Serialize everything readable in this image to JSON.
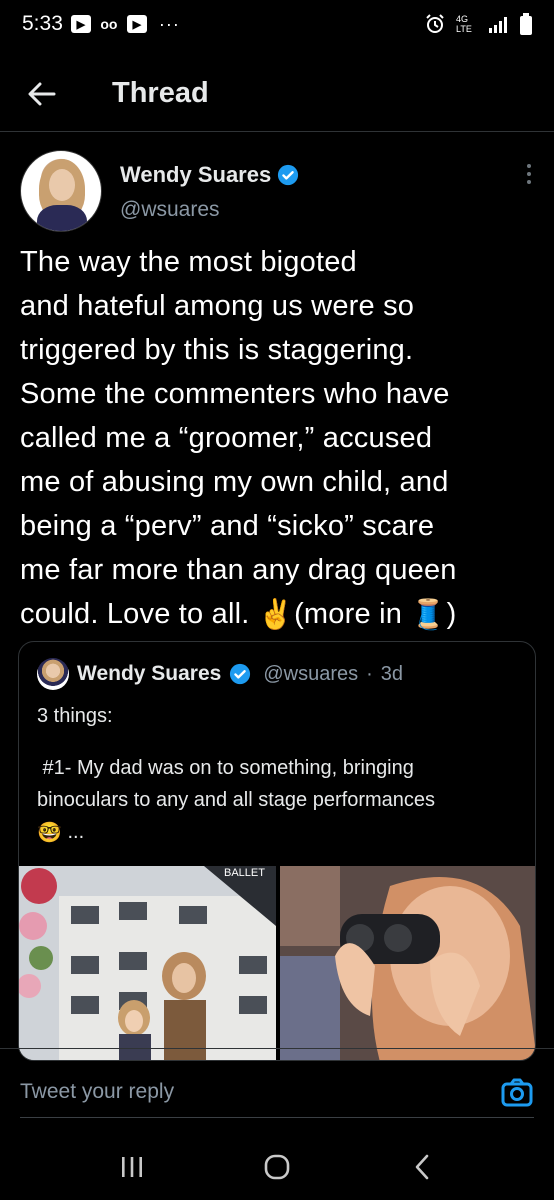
{
  "status_bar": {
    "time": "5:33",
    "left_icons": [
      "youtube-icon",
      "voicemail-icon",
      "youtube-icon",
      "more-dots-icon"
    ],
    "right_icons": [
      "alarm-icon",
      "lte-icon",
      "signal-icon",
      "battery-icon"
    ],
    "lte_label": "4G LTE"
  },
  "header": {
    "title": "Thread"
  },
  "tweet": {
    "author_name": "Wendy Suares",
    "author_handle": "@wsuares",
    "text_lines": [
      "The way the most bigoted",
      "and hateful among us were so",
      "triggered by this is staggering.",
      "Some the commenters who have",
      "called me a “groomer,” accused",
      "me of abusing my own child, and",
      "being a “perv” and “sicko” scare",
      "me far more than any drag queen"
    ],
    "last_line_before": "could. Love to all. ",
    "emoji_peace": "✌️",
    "last_line_mid": "(more in ",
    "emoji_thread": "🧵",
    "last_line_after": ")"
  },
  "quoted_tweet": {
    "author_name": "Wendy Suares",
    "author_handle": "@wsuares",
    "time_sep": "·",
    "time": "3d",
    "lines": [
      "3 things:",
      "",
      " #1- My dad was on to something, bringing",
      "binoculars to any and all stage performances"
    ],
    "emoji_nerd": "🤓",
    "ellipsis": "...",
    "image1_sign": "BALLET"
  },
  "reply_bar": {
    "placeholder": "Tweet your reply"
  },
  "colors": {
    "background": "#000000",
    "text": "#e7e9ea",
    "secondary": "#8b98a5",
    "border": "#2f3336",
    "accent": "#1d9bf0"
  }
}
